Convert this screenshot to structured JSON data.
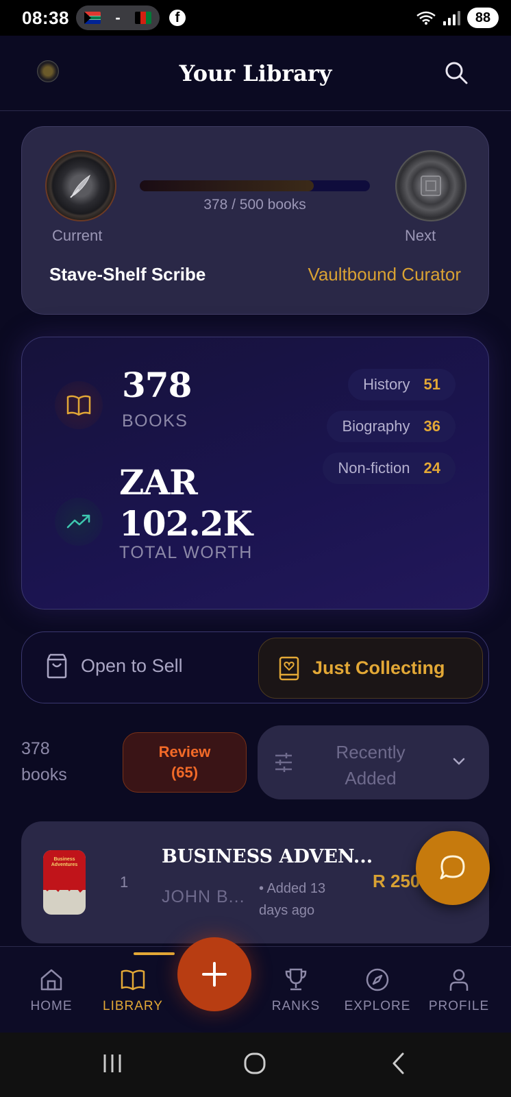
{
  "status_bar": {
    "time": "08:38",
    "pill_separator": "-",
    "battery": "88"
  },
  "header": {
    "title": "Your Library"
  },
  "rank": {
    "progress_text": "378 / 500 books",
    "progress_fraction": 0.756,
    "current_caption": "Current",
    "next_caption": "Next",
    "current_name": "Stave-Shelf Scribe",
    "next_name": "Vaultbound Curator"
  },
  "stats": {
    "books_count": "378",
    "books_label": "BOOKS",
    "worth_currency": "ZAR",
    "worth_value": "102.2K",
    "worth_label": "TOTAL WORTH",
    "genres": [
      {
        "name": "History",
        "count": "51"
      },
      {
        "name": "Biography",
        "count": "36"
      },
      {
        "name": "Non-fiction",
        "count": "24"
      }
    ]
  },
  "mode": {
    "sell_label": "Open to Sell",
    "collect_label": "Just Collecting"
  },
  "filter": {
    "count_line1": "378",
    "count_line2": "books",
    "review_line1": "Review",
    "review_line2": "(65)",
    "sort_line1": "Recently",
    "sort_line2": "Added"
  },
  "books": [
    {
      "index": "1",
      "title": "BUSINESS ADVEN...",
      "author": "JOHN B...",
      "added_line1": "• Added 13",
      "added_line2": "days ago",
      "price": "R 250",
      "cover_text": "Business Adventures"
    }
  ],
  "nav": {
    "home": "HOME",
    "library": "LIBRARY",
    "ranks": "RANKS",
    "explore": "EXPLORE",
    "profile": "PROFILE"
  },
  "colors": {
    "accent": "#e3a836",
    "background": "#0b0a22",
    "card": "#2a2847",
    "review": "#f26a28",
    "add_button": "#b83d12",
    "chat_button": "#c67a0d"
  }
}
